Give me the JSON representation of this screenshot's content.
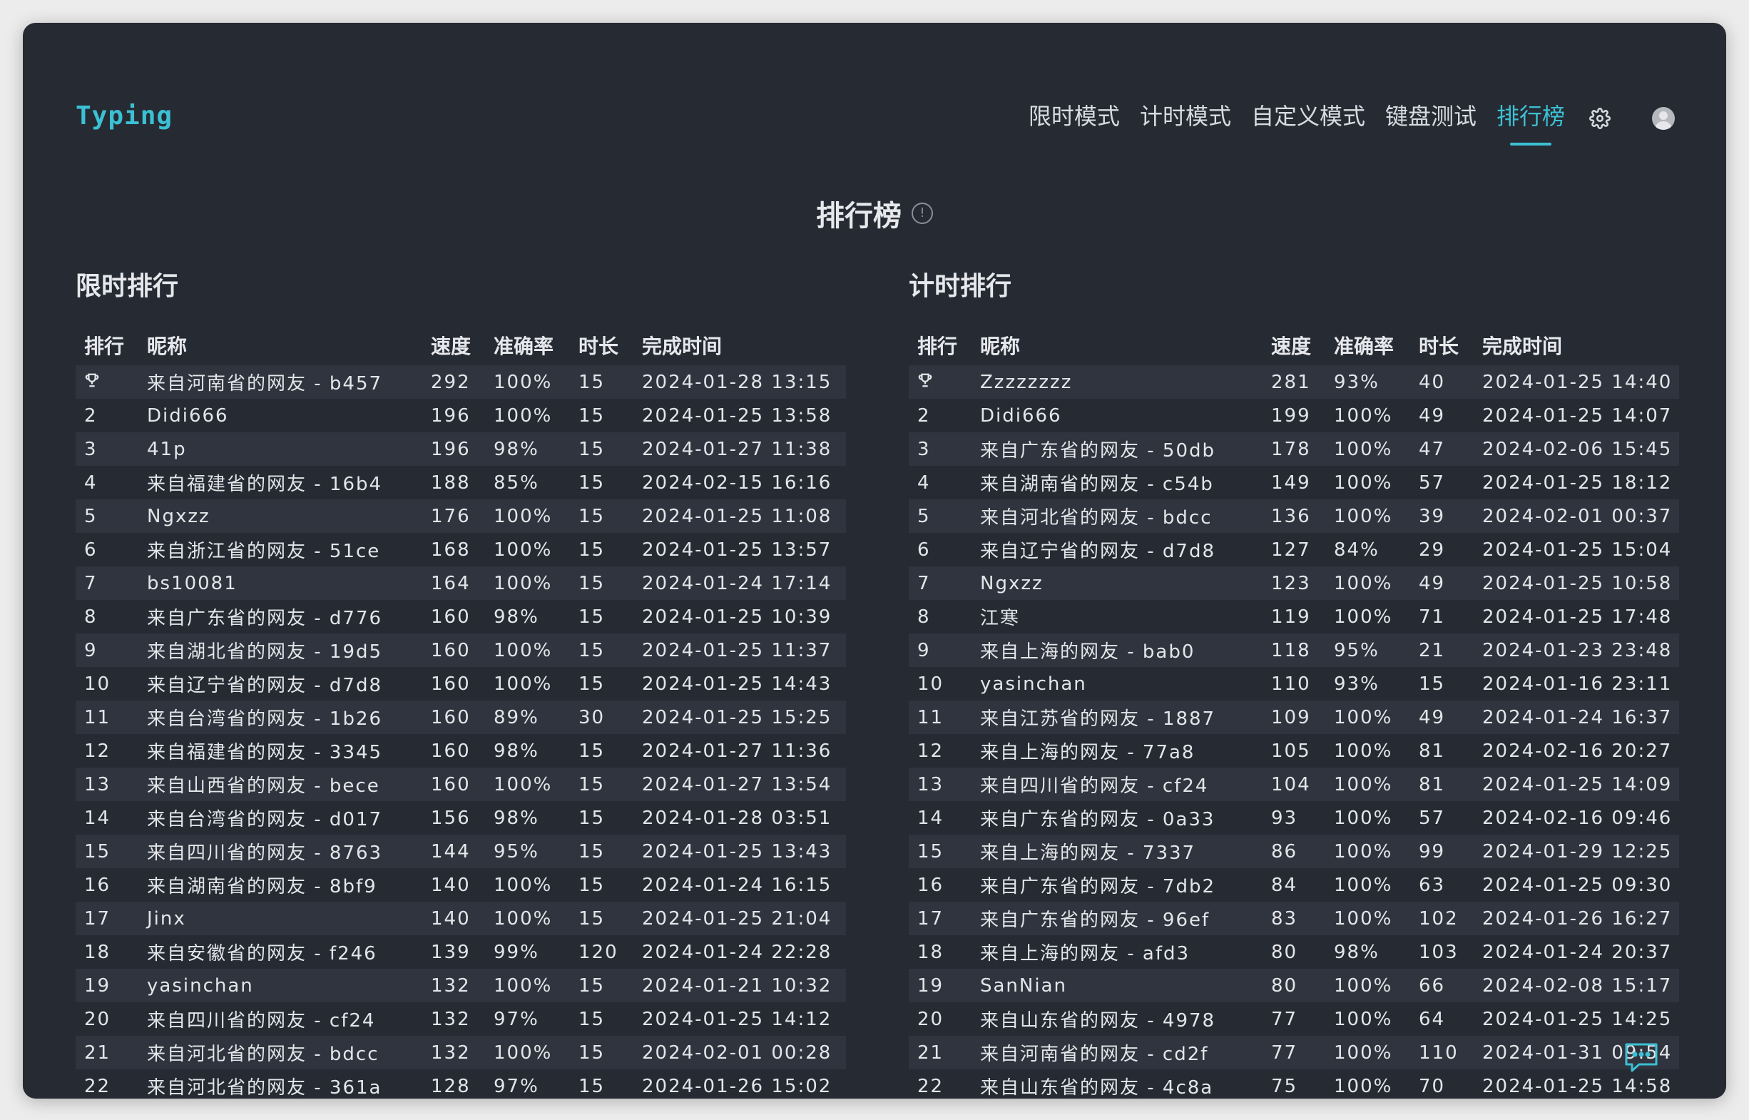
{
  "app": {
    "logo": "Typing"
  },
  "nav": {
    "items": [
      {
        "label": "限时模式",
        "active": false
      },
      {
        "label": "计时模式",
        "active": false
      },
      {
        "label": "自定义模式",
        "active": false
      },
      {
        "label": "键盘测试",
        "active": false
      },
      {
        "label": "排行榜",
        "active": true
      }
    ],
    "icons": [
      "gear-icon",
      "avatar"
    ]
  },
  "page": {
    "title": "排行榜",
    "info_icon": "info-icon"
  },
  "colors": {
    "accent": "#3cc0d4",
    "background": "#262a33",
    "row_stripe": "#30343e",
    "text": "#e3e5e9"
  },
  "leaderboards": [
    {
      "title": "限时排行",
      "columns": [
        "排行",
        "昵称",
        "速度",
        "准确率",
        "时长",
        "完成时间"
      ],
      "rows": [
        [
          "trophy",
          "来自河南省的网友 - b457",
          "292",
          "100%",
          "15",
          "2024-01-28 13:15"
        ],
        [
          "2",
          "Didi666",
          "196",
          "100%",
          "15",
          "2024-01-25 13:58"
        ],
        [
          "3",
          "41p",
          "196",
          "98%",
          "15",
          "2024-01-27 11:38"
        ],
        [
          "4",
          "来自福建省的网友 - 16b4",
          "188",
          "85%",
          "15",
          "2024-02-15 16:16"
        ],
        [
          "5",
          "Ngxzz",
          "176",
          "100%",
          "15",
          "2024-01-25 11:08"
        ],
        [
          "6",
          "来自浙江省的网友 - 51ce",
          "168",
          "100%",
          "15",
          "2024-01-25 13:57"
        ],
        [
          "7",
          "bs10081",
          "164",
          "100%",
          "15",
          "2024-01-24 17:14"
        ],
        [
          "8",
          "来自广东省的网友 - d776",
          "160",
          "98%",
          "15",
          "2024-01-25 10:39"
        ],
        [
          "9",
          "来自湖北省的网友 - 19d5",
          "160",
          "100%",
          "15",
          "2024-01-25 11:37"
        ],
        [
          "10",
          "来自辽宁省的网友 - d7d8",
          "160",
          "100%",
          "15",
          "2024-01-25 14:43"
        ],
        [
          "11",
          "来自台湾省的网友 - 1b26",
          "160",
          "89%",
          "30",
          "2024-01-25 15:25"
        ],
        [
          "12",
          "来自福建省的网友 - 3345",
          "160",
          "98%",
          "15",
          "2024-01-27 11:36"
        ],
        [
          "13",
          "来自山西省的网友 - bece",
          "160",
          "100%",
          "15",
          "2024-01-27 13:54"
        ],
        [
          "14",
          "来自台湾省的网友 - d017",
          "156",
          "98%",
          "15",
          "2024-01-28 03:51"
        ],
        [
          "15",
          "来自四川省的网友 - 8763",
          "144",
          "95%",
          "15",
          "2024-01-25 13:43"
        ],
        [
          "16",
          "来自湖南省的网友 - 8bf9",
          "140",
          "100%",
          "15",
          "2024-01-24 16:15"
        ],
        [
          "17",
          "Jinx",
          "140",
          "100%",
          "15",
          "2024-01-25 21:04"
        ],
        [
          "18",
          "来自安徽省的网友 - f246",
          "139",
          "99%",
          "120",
          "2024-01-24 22:28"
        ],
        [
          "19",
          "yasinchan",
          "132",
          "100%",
          "15",
          "2024-01-21 10:32"
        ],
        [
          "20",
          "来自四川省的网友 - cf24",
          "132",
          "97%",
          "15",
          "2024-01-25 14:12"
        ],
        [
          "21",
          "来自河北省的网友 - bdcc",
          "132",
          "100%",
          "15",
          "2024-02-01 00:28"
        ],
        [
          "22",
          "来自河北省的网友 - 361a",
          "128",
          "97%",
          "15",
          "2024-01-26 15:02"
        ]
      ]
    },
    {
      "title": "计时排行",
      "columns": [
        "排行",
        "昵称",
        "速度",
        "准确率",
        "时长",
        "完成时间"
      ],
      "rows": [
        [
          "trophy",
          "Zzzzzzzz",
          "281",
          "93%",
          "40",
          "2024-01-25 14:40"
        ],
        [
          "2",
          "Didi666",
          "199",
          "100%",
          "49",
          "2024-01-25 14:07"
        ],
        [
          "3",
          "来自广东省的网友 - 50db",
          "178",
          "100%",
          "47",
          "2024-02-06 15:45"
        ],
        [
          "4",
          "来自湖南省的网友 - c54b",
          "149",
          "100%",
          "57",
          "2024-01-25 18:12"
        ],
        [
          "5",
          "来自河北省的网友 - bdcc",
          "136",
          "100%",
          "39",
          "2024-02-01 00:37"
        ],
        [
          "6",
          "来自辽宁省的网友 - d7d8",
          "127",
          "84%",
          "29",
          "2024-01-25 15:04"
        ],
        [
          "7",
          "Ngxzz",
          "123",
          "100%",
          "49",
          "2024-01-25 10:58"
        ],
        [
          "8",
          "江寒",
          "119",
          "100%",
          "71",
          "2024-01-25 17:48"
        ],
        [
          "9",
          "来自上海的网友 - bab0",
          "118",
          "95%",
          "21",
          "2024-01-23 23:48"
        ],
        [
          "10",
          "yasinchan",
          "110",
          "93%",
          "15",
          "2024-01-16 23:11"
        ],
        [
          "11",
          "来自江苏省的网友 - 1887",
          "109",
          "100%",
          "49",
          "2024-01-24 16:37"
        ],
        [
          "12",
          "来自上海的网友 - 77a8",
          "105",
          "100%",
          "81",
          "2024-02-16 20:27"
        ],
        [
          "13",
          "来自四川省的网友 - cf24",
          "104",
          "100%",
          "81",
          "2024-01-25 14:09"
        ],
        [
          "14",
          "来自广东省的网友 - 0a33",
          "93",
          "100%",
          "57",
          "2024-02-16 09:46"
        ],
        [
          "15",
          "来自上海的网友 - 7337",
          "86",
          "100%",
          "99",
          "2024-01-29 12:25"
        ],
        [
          "16",
          "来自广东省的网友 - 7db2",
          "84",
          "100%",
          "63",
          "2024-01-25 09:30"
        ],
        [
          "17",
          "来自广东省的网友 - 96ef",
          "83",
          "100%",
          "102",
          "2024-01-26 16:27"
        ],
        [
          "18",
          "来自上海的网友 - afd3",
          "80",
          "98%",
          "103",
          "2024-01-24 20:37"
        ],
        [
          "19",
          "SanNian",
          "80",
          "100%",
          "66",
          "2024-02-08 15:17"
        ],
        [
          "20",
          "来自山东省的网友 - 4978",
          "77",
          "100%",
          "64",
          "2024-01-25 14:25"
        ],
        [
          "21",
          "来自河南省的网友 - cd2f",
          "77",
          "100%",
          "110",
          "2024-01-31 09:54"
        ],
        [
          "22",
          "来自山东省的网友 - 4c8a",
          "75",
          "100%",
          "70",
          "2024-01-25 14:58"
        ]
      ]
    }
  ],
  "floating": {
    "icon": "chat-icon"
  }
}
